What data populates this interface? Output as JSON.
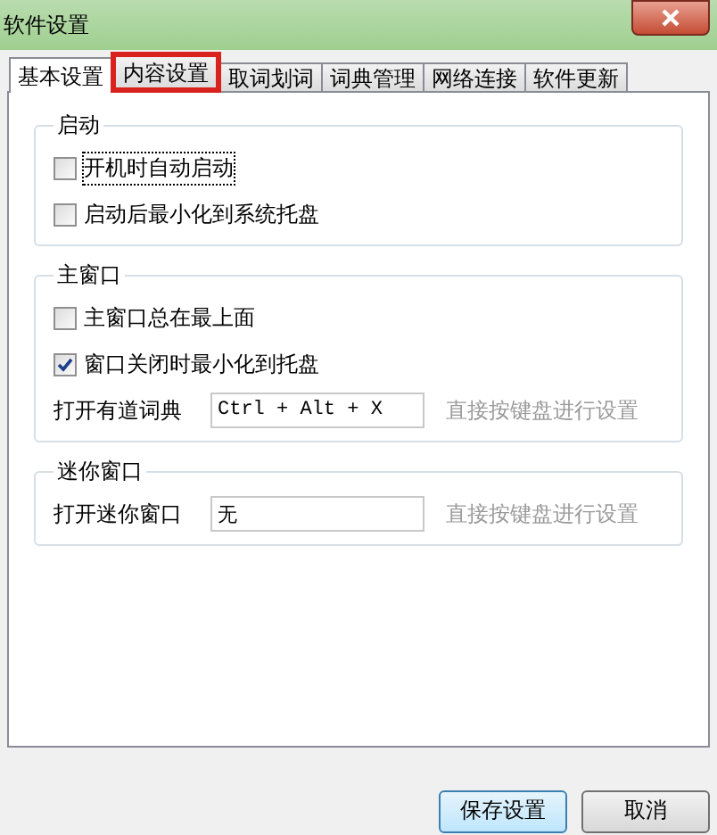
{
  "window": {
    "title": "软件设置"
  },
  "tabs": [
    {
      "label": "基本设置",
      "selected": true,
      "highlighted": false
    },
    {
      "label": "内容设置",
      "selected": false,
      "highlighted": true
    },
    {
      "label": "取词划词",
      "selected": false,
      "highlighted": false
    },
    {
      "label": "词典管理",
      "selected": false,
      "highlighted": false
    },
    {
      "label": "网络连接",
      "selected": false,
      "highlighted": false
    },
    {
      "label": "软件更新",
      "selected": false,
      "highlighted": false
    }
  ],
  "groups": [
    {
      "title": "启动",
      "rows": [
        {
          "kind": "checkbox",
          "label": "开机时自动启动",
          "checked": false,
          "focused": true
        },
        {
          "kind": "checkbox",
          "label": "启动后最小化到系统托盘",
          "checked": false,
          "focused": false
        }
      ]
    },
    {
      "title": "主窗口",
      "rows": [
        {
          "kind": "checkbox",
          "label": "主窗口总在最上面",
          "checked": false,
          "focused": false
        },
        {
          "kind": "checkbox",
          "label": "窗口关闭时最小化到托盘",
          "checked": true,
          "focused": false
        },
        {
          "kind": "hotkey",
          "label": "打开有道词典",
          "value": "Ctrl + Alt + X",
          "hint": "直接按键盘进行设置"
        }
      ]
    },
    {
      "title": "迷你窗口",
      "rows": [
        {
          "kind": "hotkey",
          "label": "打开迷你窗口",
          "value": "无",
          "hint": "直接按键盘进行设置"
        }
      ]
    }
  ],
  "buttons": [
    {
      "label": "保存设置",
      "default": true
    },
    {
      "label": "取消",
      "default": false
    }
  ]
}
